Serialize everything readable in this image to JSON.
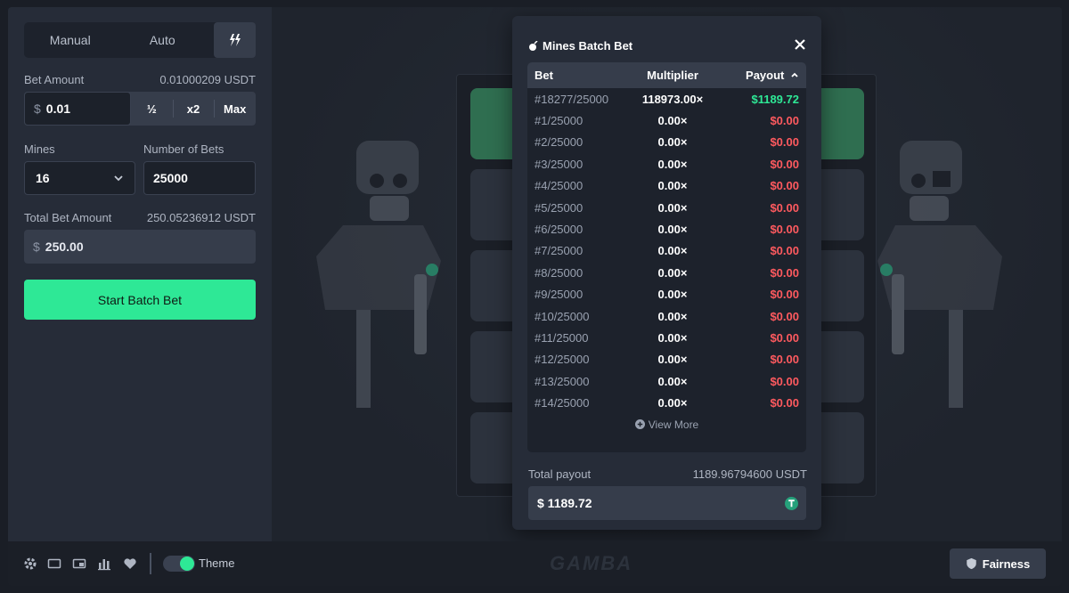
{
  "tabs": {
    "manual": "Manual",
    "auto": "Auto"
  },
  "bet": {
    "label": "Bet Amount",
    "usdt": "0.01000209 USDT",
    "currency": "$",
    "value": "0.01",
    "half": "½",
    "double": "x2",
    "max": "Max"
  },
  "mines": {
    "label": "Mines",
    "value": "16"
  },
  "num_bets": {
    "label": "Number of Bets",
    "value": "25000"
  },
  "total_bet": {
    "label": "Total Bet Amount",
    "usdt": "250.05236912 USDT",
    "currency": "$",
    "value": "250.00"
  },
  "start_label": "Start Batch Bet",
  "modal": {
    "title": "Mines Batch Bet",
    "headers": {
      "bet": "Bet",
      "multiplier": "Multiplier",
      "payout": "Payout"
    },
    "rows": [
      {
        "bet": "#18277/25000",
        "multiplier": "118973.00×",
        "payout": "$1189.72",
        "win": true
      },
      {
        "bet": "#1/25000",
        "multiplier": "0.00×",
        "payout": "$0.00"
      },
      {
        "bet": "#2/25000",
        "multiplier": "0.00×",
        "payout": "$0.00"
      },
      {
        "bet": "#3/25000",
        "multiplier": "0.00×",
        "payout": "$0.00"
      },
      {
        "bet": "#4/25000",
        "multiplier": "0.00×",
        "payout": "$0.00"
      },
      {
        "bet": "#5/25000",
        "multiplier": "0.00×",
        "payout": "$0.00"
      },
      {
        "bet": "#6/25000",
        "multiplier": "0.00×",
        "payout": "$0.00"
      },
      {
        "bet": "#7/25000",
        "multiplier": "0.00×",
        "payout": "$0.00"
      },
      {
        "bet": "#8/25000",
        "multiplier": "0.00×",
        "payout": "$0.00"
      },
      {
        "bet": "#9/25000",
        "multiplier": "0.00×",
        "payout": "$0.00"
      },
      {
        "bet": "#10/25000",
        "multiplier": "0.00×",
        "payout": "$0.00"
      },
      {
        "bet": "#11/25000",
        "multiplier": "0.00×",
        "payout": "$0.00"
      },
      {
        "bet": "#12/25000",
        "multiplier": "0.00×",
        "payout": "$0.00"
      },
      {
        "bet": "#13/25000",
        "multiplier": "0.00×",
        "payout": "$0.00"
      },
      {
        "bet": "#14/25000",
        "multiplier": "0.00×",
        "payout": "$0.00"
      }
    ],
    "view_more": "View More",
    "total_payout_label": "Total payout",
    "total_payout_usdt": "1189.96794600 USDT",
    "total_payout_value": "$ 1189.72"
  },
  "footer": {
    "theme": "Theme",
    "logo": "GAMBA",
    "fairness": "Fairness"
  },
  "colors": {
    "accent": "#2ee896",
    "loss": "#ff5a5f",
    "panel": "#262c38",
    "tether": "#26a17b"
  },
  "icons": [
    "gear-icon",
    "theater-icon",
    "picture-in-picture-icon",
    "stats-icon",
    "heart-icon",
    "shield-icon",
    "tether-icon",
    "plus-circle-icon",
    "close-icon",
    "chevron-down-icon",
    "chevron-up-icon",
    "lightning-icon",
    "mine-icon"
  ]
}
